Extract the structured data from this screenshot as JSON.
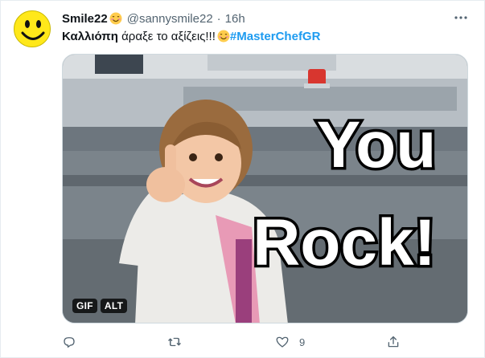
{
  "tweet": {
    "display_name": "Smile22",
    "handle": "@sannysmile22",
    "separator": "·",
    "time": "16h",
    "text_name": "Καλλιόπη",
    "text_body": " άραξε το αξίζεις!!!",
    "hashtag": "#MasterChefGR"
  },
  "media": {
    "caption_line1": "You",
    "caption_line2": "Rock!",
    "badge_gif": "GIF",
    "badge_alt": "ALT"
  },
  "actions": {
    "reply_count": "",
    "retweet_count": "",
    "like_count": "9",
    "share_count": ""
  },
  "colors": {
    "accent": "#1d9bf0",
    "muted": "#536471",
    "avatar_yellow": "#ffe81a"
  },
  "icons": {
    "avatar": "smiley-face-icon",
    "name_emoji": "smiling-face-emoji-icon",
    "more": "more-horizontal-icon",
    "reply": "reply-icon",
    "retweet": "retweet-icon",
    "like": "heart-icon",
    "share": "share-icon"
  }
}
